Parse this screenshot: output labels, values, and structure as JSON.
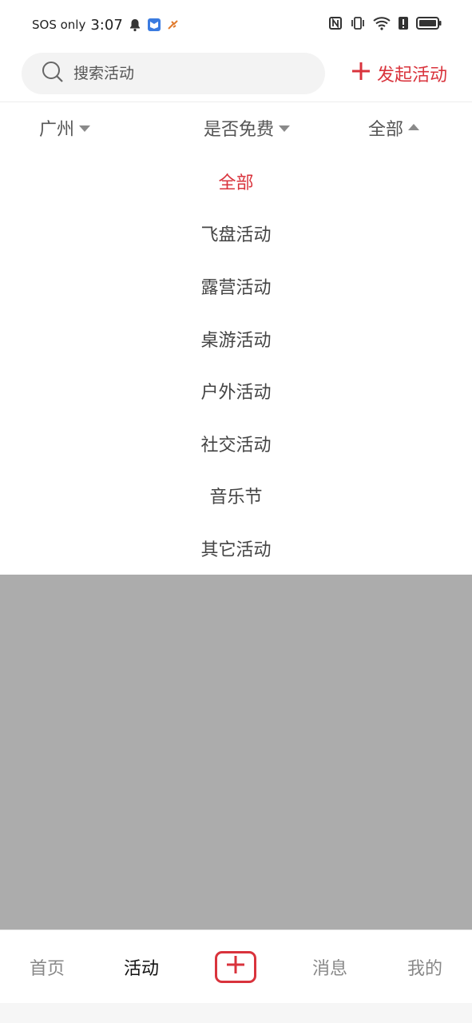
{
  "status_bar": {
    "carrier": "SOS only",
    "time": "3:07",
    "icons": [
      "bell-icon",
      "app-icon",
      "app-icon-2",
      "nfc-icon",
      "vibrate-icon",
      "wifi-icon",
      "alert-icon",
      "battery-icon"
    ]
  },
  "search": {
    "placeholder": "搜索活动"
  },
  "header": {
    "launch_label": "发起活动"
  },
  "filters": {
    "city": "广州",
    "free": "是否免费",
    "category": "全部"
  },
  "dropdown": {
    "options": [
      "全部",
      "飞盘活动",
      "露营活动",
      "桌游活动",
      "户外活动",
      "社交活动",
      "音乐节",
      "其它活动"
    ],
    "selected_index": 0
  },
  "nav": {
    "home": "首页",
    "activity": "活动",
    "messages": "消息",
    "me": "我的"
  },
  "colors": {
    "accent": "#d9333c",
    "overlay": "#acacac"
  }
}
